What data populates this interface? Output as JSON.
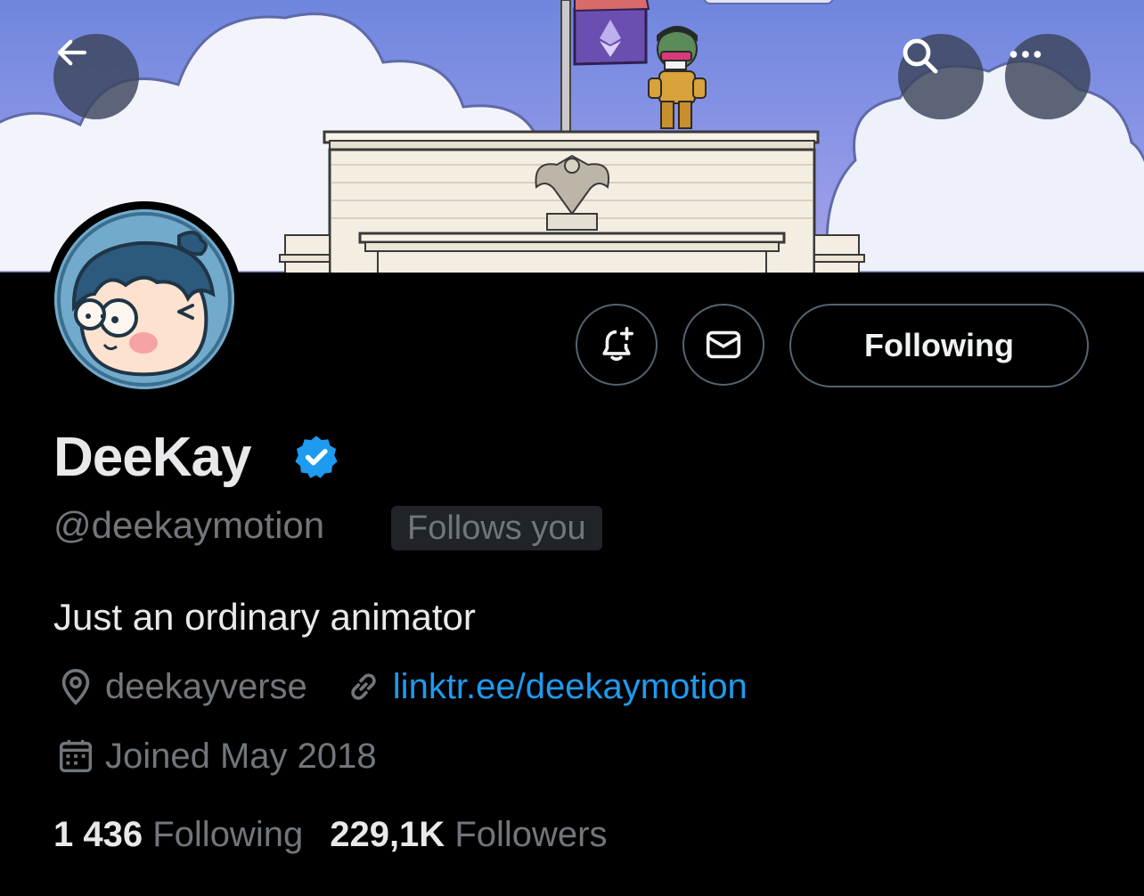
{
  "banner": {
    "sky_color": "#8c96e6"
  },
  "toolbar": {
    "back_icon": "arrow-left-icon",
    "search_icon": "search-icon",
    "more_icon": "more-horizontal-icon"
  },
  "profile": {
    "display_name": "DeeKay",
    "verified": true,
    "handle": "@deekaymotion",
    "follows_you_label": "Follows you",
    "bio": "Just an ordinary animator",
    "location": "deekayverse",
    "website": "linktr.ee/deekaymotion",
    "joined": "Joined May 2018"
  },
  "actions": {
    "notify_icon": "bell-plus-icon",
    "message_icon": "envelope-icon",
    "following_label": "Following"
  },
  "stats": {
    "following_count": "1 436",
    "following_label": "Following",
    "followers_count": "229,1K",
    "followers_label": "Followers"
  },
  "colors": {
    "background": "#000000",
    "accent": "#1d9bf0",
    "text_primary": "#e7e9ea",
    "text_secondary": "#71767b",
    "border": "#536471"
  }
}
